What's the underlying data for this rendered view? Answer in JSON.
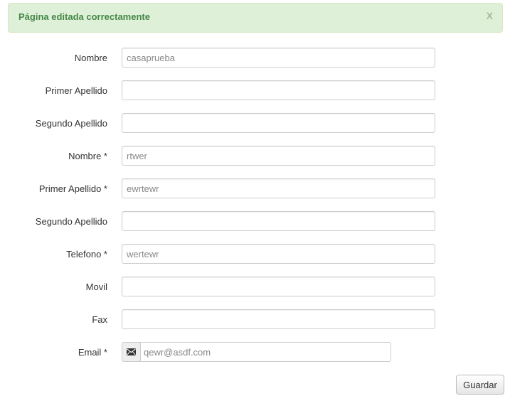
{
  "alert": {
    "message": "Página editada correctamente",
    "close_label": "X"
  },
  "form": {
    "fields": [
      {
        "label": "Nombre",
        "value": "casaprueba"
      },
      {
        "label": "Primer Apellido",
        "value": ""
      },
      {
        "label": "Segundo Apellido",
        "value": ""
      },
      {
        "label": "Nombre *",
        "value": "rtwer"
      },
      {
        "label": "Primer Apellido *",
        "value": "ewrtewr"
      },
      {
        "label": "Segundo Apellido",
        "value": ""
      },
      {
        "label": "Telefono *",
        "value": "wertewr"
      },
      {
        "label": "Movil",
        "value": ""
      },
      {
        "label": "Fax",
        "value": ""
      }
    ],
    "email": {
      "label": "Email *",
      "value": "qewr@asdf.com",
      "icon": "envelope-icon"
    },
    "save_label": "Guardar"
  }
}
